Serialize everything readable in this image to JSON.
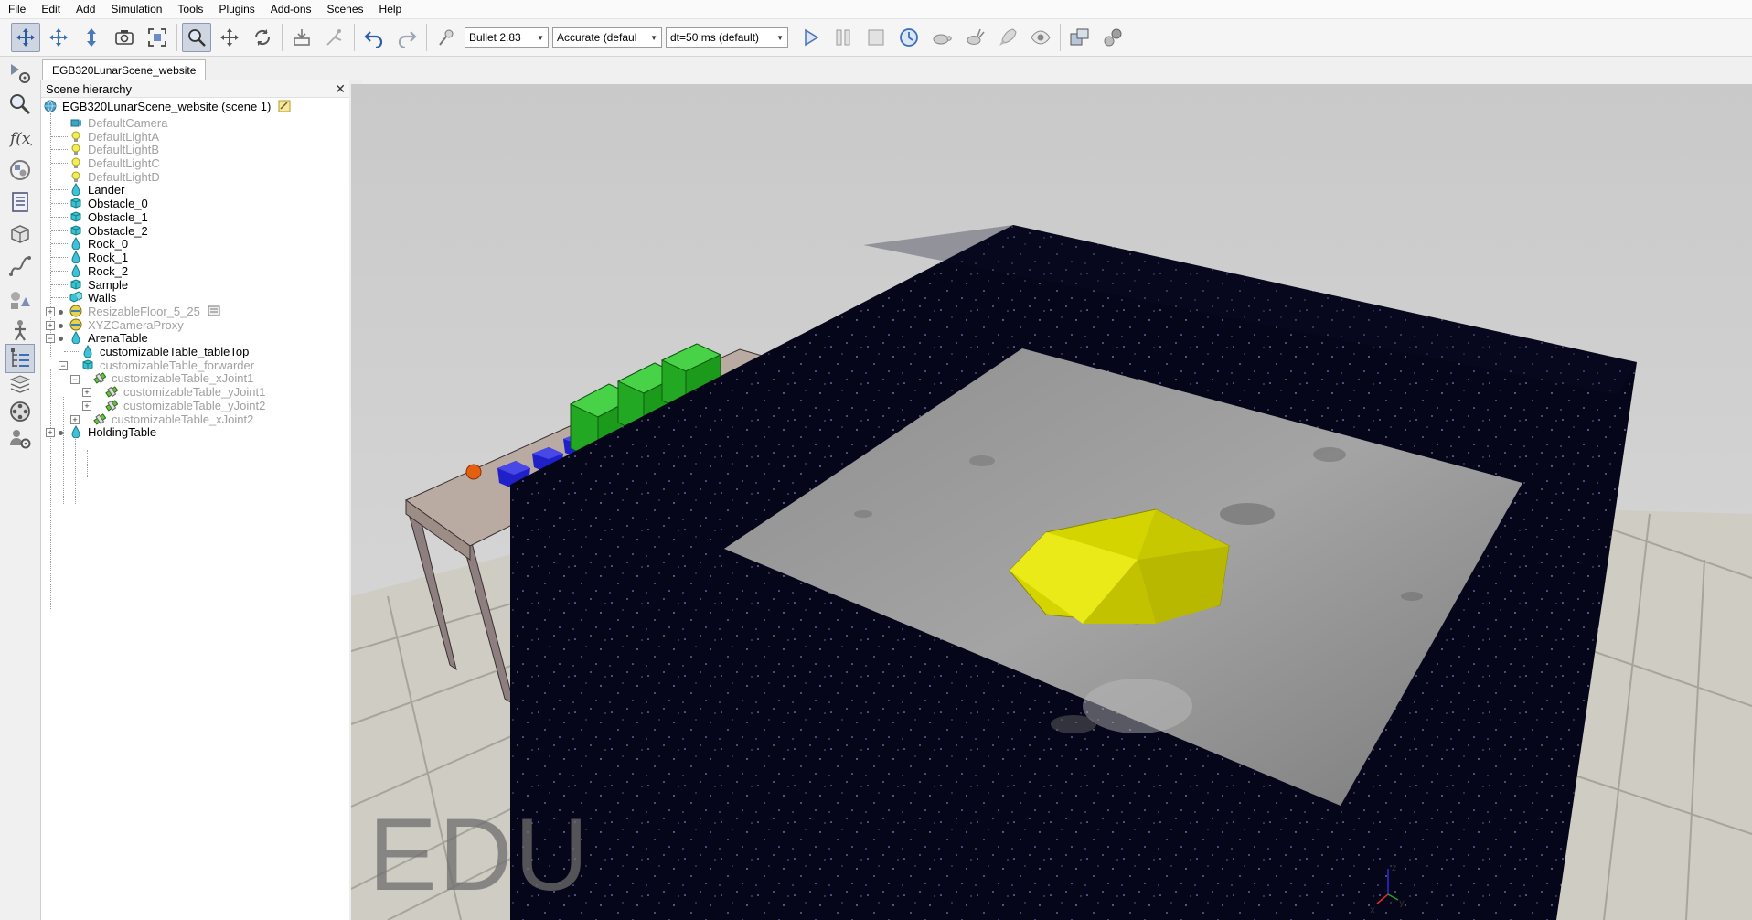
{
  "menu": [
    "File",
    "Edit",
    "Add",
    "Simulation",
    "Tools",
    "Plugins",
    "Add-ons",
    "Scenes",
    "Help"
  ],
  "toolbar": {
    "engine": "Bullet 2.83",
    "accuracy": "Accurate (defaul",
    "timestep": "dt=50 ms (default)"
  },
  "tab": {
    "label": "EGB320LunarScene_website"
  },
  "hierarchy": {
    "title": "Scene hierarchy",
    "root": "EGB320LunarScene_website (scene 1)",
    "items": [
      {
        "label": "DefaultCamera"
      },
      {
        "label": "DefaultLightA"
      },
      {
        "label": "DefaultLightB"
      },
      {
        "label": "DefaultLightC"
      },
      {
        "label": "DefaultLightD"
      },
      {
        "label": "Lander"
      },
      {
        "label": "Obstacle_0"
      },
      {
        "label": "Obstacle_1"
      },
      {
        "label": "Obstacle_2"
      },
      {
        "label": "Rock_0"
      },
      {
        "label": "Rock_1"
      },
      {
        "label": "Rock_2"
      },
      {
        "label": "Sample"
      },
      {
        "label": "Walls"
      },
      {
        "label": "ResizableFloor_5_25"
      },
      {
        "label": "XYZCameraProxy"
      },
      {
        "label": "ArenaTable"
      },
      {
        "label": "customizableTable_tableTop"
      },
      {
        "label": "customizableTable_forwarder"
      },
      {
        "label": "customizableTable_xJoint1"
      },
      {
        "label": "customizableTable_yJoint1"
      },
      {
        "label": "customizableTable_yJoint2"
      },
      {
        "label": "customizableTable_xJoint2"
      },
      {
        "label": "HoldingTable"
      }
    ]
  },
  "viewport": {
    "watermark": "EDU",
    "axes": {
      "x": "x",
      "y": "y",
      "z": "z"
    }
  },
  "colors": {
    "accent": "#cfd6e2",
    "obstacle": "#2fb52f",
    "rock": "#2a2ad0",
    "sample": "#e06010",
    "lander": "#d8d800",
    "walls": "#05051a"
  }
}
